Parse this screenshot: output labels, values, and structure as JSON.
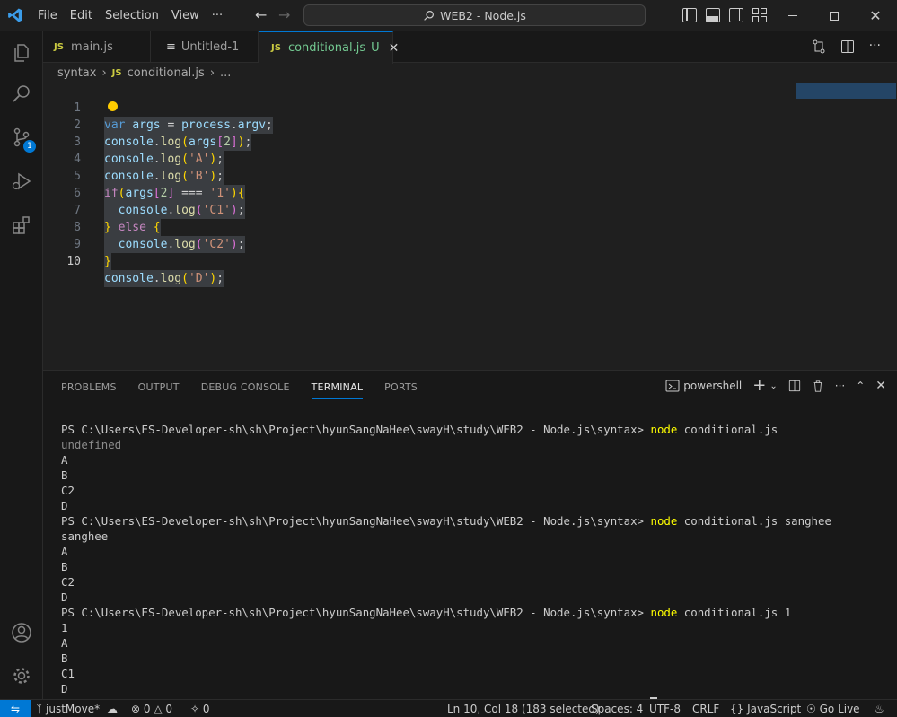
{
  "menu": [
    "File",
    "Edit",
    "Selection",
    "View",
    "···"
  ],
  "search": "WEB2 - Node.js",
  "tabs": [
    {
      "icon": "JS",
      "label": "main.js"
    },
    {
      "icon": "≡",
      "label": "Untitled-1"
    },
    {
      "icon": "JS",
      "label": "conditional.js",
      "status": "U"
    }
  ],
  "breadcrumb": {
    "folder": "syntax",
    "file": "conditional.js",
    "more": "..."
  },
  "badge_count": "1",
  "editor": {
    "lines": [
      {
        "num": "1"
      },
      {
        "num": "2"
      },
      {
        "num": "3"
      },
      {
        "num": "4"
      },
      {
        "num": "5"
      },
      {
        "num": "6"
      },
      {
        "num": "7"
      },
      {
        "num": "8"
      },
      {
        "num": "9"
      },
      {
        "num": "10"
      }
    ]
  },
  "panel": {
    "tabs": [
      "PROBLEMS",
      "OUTPUT",
      "DEBUG CONSOLE",
      "TERMINAL",
      "PORTS"
    ],
    "shell": "powershell"
  },
  "terminal": {
    "prompt": "PS C:\\Users\\ES-Developer-sh\\sh\\Project\\hyunSangNaHee\\swayH\\study\\WEB2 - Node.js\\syntax>",
    "node": "node",
    "runs": [
      {
        "args": "conditional.js",
        "output": [
          "undefined",
          "A",
          "B",
          "C2",
          "D"
        ]
      },
      {
        "args": "conditional.js sanghee",
        "output": [
          "sanghee",
          "A",
          "B",
          "C2",
          "D"
        ]
      },
      {
        "args": "conditional.js 1",
        "output": [
          "1",
          "A",
          "B",
          "C1",
          "D"
        ]
      }
    ]
  },
  "status": {
    "branch": "justMove*",
    "errors": "0",
    "warnings": "0",
    "ports": "0",
    "position": "Ln 10, Col 18 (183 selected)",
    "spaces": "Spaces: 4",
    "encoding": "UTF-8",
    "eol": "CRLF",
    "language": "JavaScript",
    "golive": "Go Live"
  },
  "colors": {
    "accent": "#0078d4",
    "js": "#cbcb41",
    "editor_bg": "#1f1f1f",
    "panel_bg": "#181818"
  }
}
